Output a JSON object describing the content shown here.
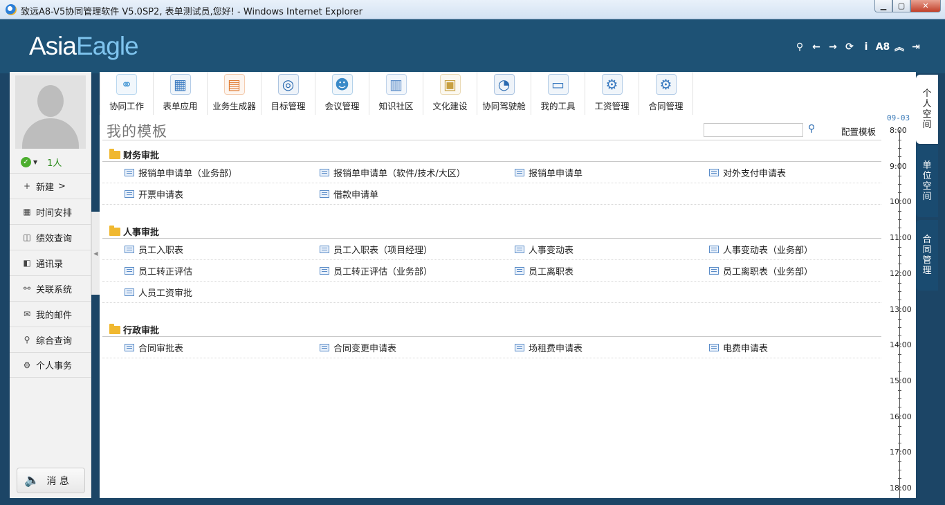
{
  "window": {
    "title": "致远A8-V5协同管理软件 V5.0SP2, 表单测试员,您好! - Windows Internet Explorer",
    "minimize": "▁",
    "maximize": "▢",
    "close": "✕"
  },
  "header": {
    "logo_part1": "Asia",
    "logo_part2": "Eagle",
    "tools": [
      {
        "icon": "search-icon",
        "glyph": "⚲"
      },
      {
        "icon": "back-icon",
        "glyph": "←"
      },
      {
        "icon": "forward-icon",
        "glyph": "→"
      },
      {
        "icon": "refresh-icon",
        "glyph": "⟳"
      },
      {
        "icon": "info-icon",
        "glyph": "i"
      },
      {
        "icon": "a8-icon",
        "glyph": "A8"
      },
      {
        "icon": "collapse-up-icon",
        "glyph": "︽"
      },
      {
        "icon": "logout-icon",
        "glyph": "⇥"
      }
    ]
  },
  "sidebar": {
    "online_count": "1人",
    "items": [
      {
        "label": "新建",
        "suffix": ">",
        "glyph": "+"
      },
      {
        "label": "时间安排",
        "glyph": "▦"
      },
      {
        "label": "绩效查询",
        "glyph": "◫"
      },
      {
        "label": "通讯录",
        "glyph": "◧"
      },
      {
        "label": "关联系统",
        "glyph": "⚯"
      },
      {
        "label": "我的邮件",
        "glyph": "✉"
      },
      {
        "label": "综合查询",
        "glyph": "⚲"
      },
      {
        "label": "个人事务",
        "glyph": "⚙"
      }
    ],
    "message_label": "消 息"
  },
  "toolbar": {
    "items": [
      {
        "label": "协同工作",
        "glyph": "⚭",
        "color": "#4a9ad6"
      },
      {
        "label": "表单应用",
        "glyph": "▦",
        "color": "#3a7ac0"
      },
      {
        "label": "业务生成器",
        "glyph": "▤",
        "color": "#e07a30"
      },
      {
        "label": "目标管理",
        "glyph": "◎",
        "color": "#2a6ab0"
      },
      {
        "label": "会议管理",
        "glyph": "☻",
        "color": "#3a8ac8"
      },
      {
        "label": "知识社区",
        "glyph": "▥",
        "color": "#5a8cc8"
      },
      {
        "label": "文化建设",
        "glyph": "▣",
        "color": "#c8a040"
      },
      {
        "label": "协同驾驶舱",
        "glyph": "◔",
        "color": "#2a6ab0"
      },
      {
        "label": "我的工具",
        "glyph": "▭",
        "color": "#3a7ac0"
      },
      {
        "label": "工资管理",
        "glyph": "⚙",
        "color": "#3a7ac0"
      },
      {
        "label": "合同管理",
        "glyph": "⚙",
        "color": "#3a7ac0"
      }
    ]
  },
  "main": {
    "page_title": "我的模板",
    "search_placeholder": "",
    "search_glyph": "⚲",
    "config_link": "配置模板",
    "sections": [
      {
        "title": "财务审批",
        "rows": [
          [
            "报销单申请单（业务部）",
            "报销单申请单（软件/技术/大区）",
            "报销单申请单",
            "对外支付申请表"
          ],
          [
            "开票申请表",
            "借款申请单"
          ]
        ]
      },
      {
        "title": "人事审批",
        "rows": [
          [
            "员工入职表",
            "员工入职表（项目经理）",
            "人事变动表",
            "人事变动表（业务部）"
          ],
          [
            "员工转正评估",
            "员工转正评估（业务部）",
            "员工离职表",
            "员工离职表（业务部）"
          ],
          [
            "人员工资审批"
          ]
        ]
      },
      {
        "title": "行政审批",
        "rows": [
          [
            "合同审批表",
            "合同变更申请表",
            "场租费申请表",
            "电费申请表"
          ]
        ]
      }
    ]
  },
  "timeline": {
    "date": "09-03",
    "hours": [
      "8:00",
      "9:00",
      "10:00",
      "11:00",
      "12:00",
      "13:00",
      "14:00",
      "15:00",
      "16:00",
      "17:00",
      "18:00"
    ]
  },
  "right_tabs": [
    {
      "label": "个人空间",
      "active": true
    },
    {
      "label": "单位空间",
      "active": false
    },
    {
      "label": "合同管理",
      "active": false
    }
  ]
}
